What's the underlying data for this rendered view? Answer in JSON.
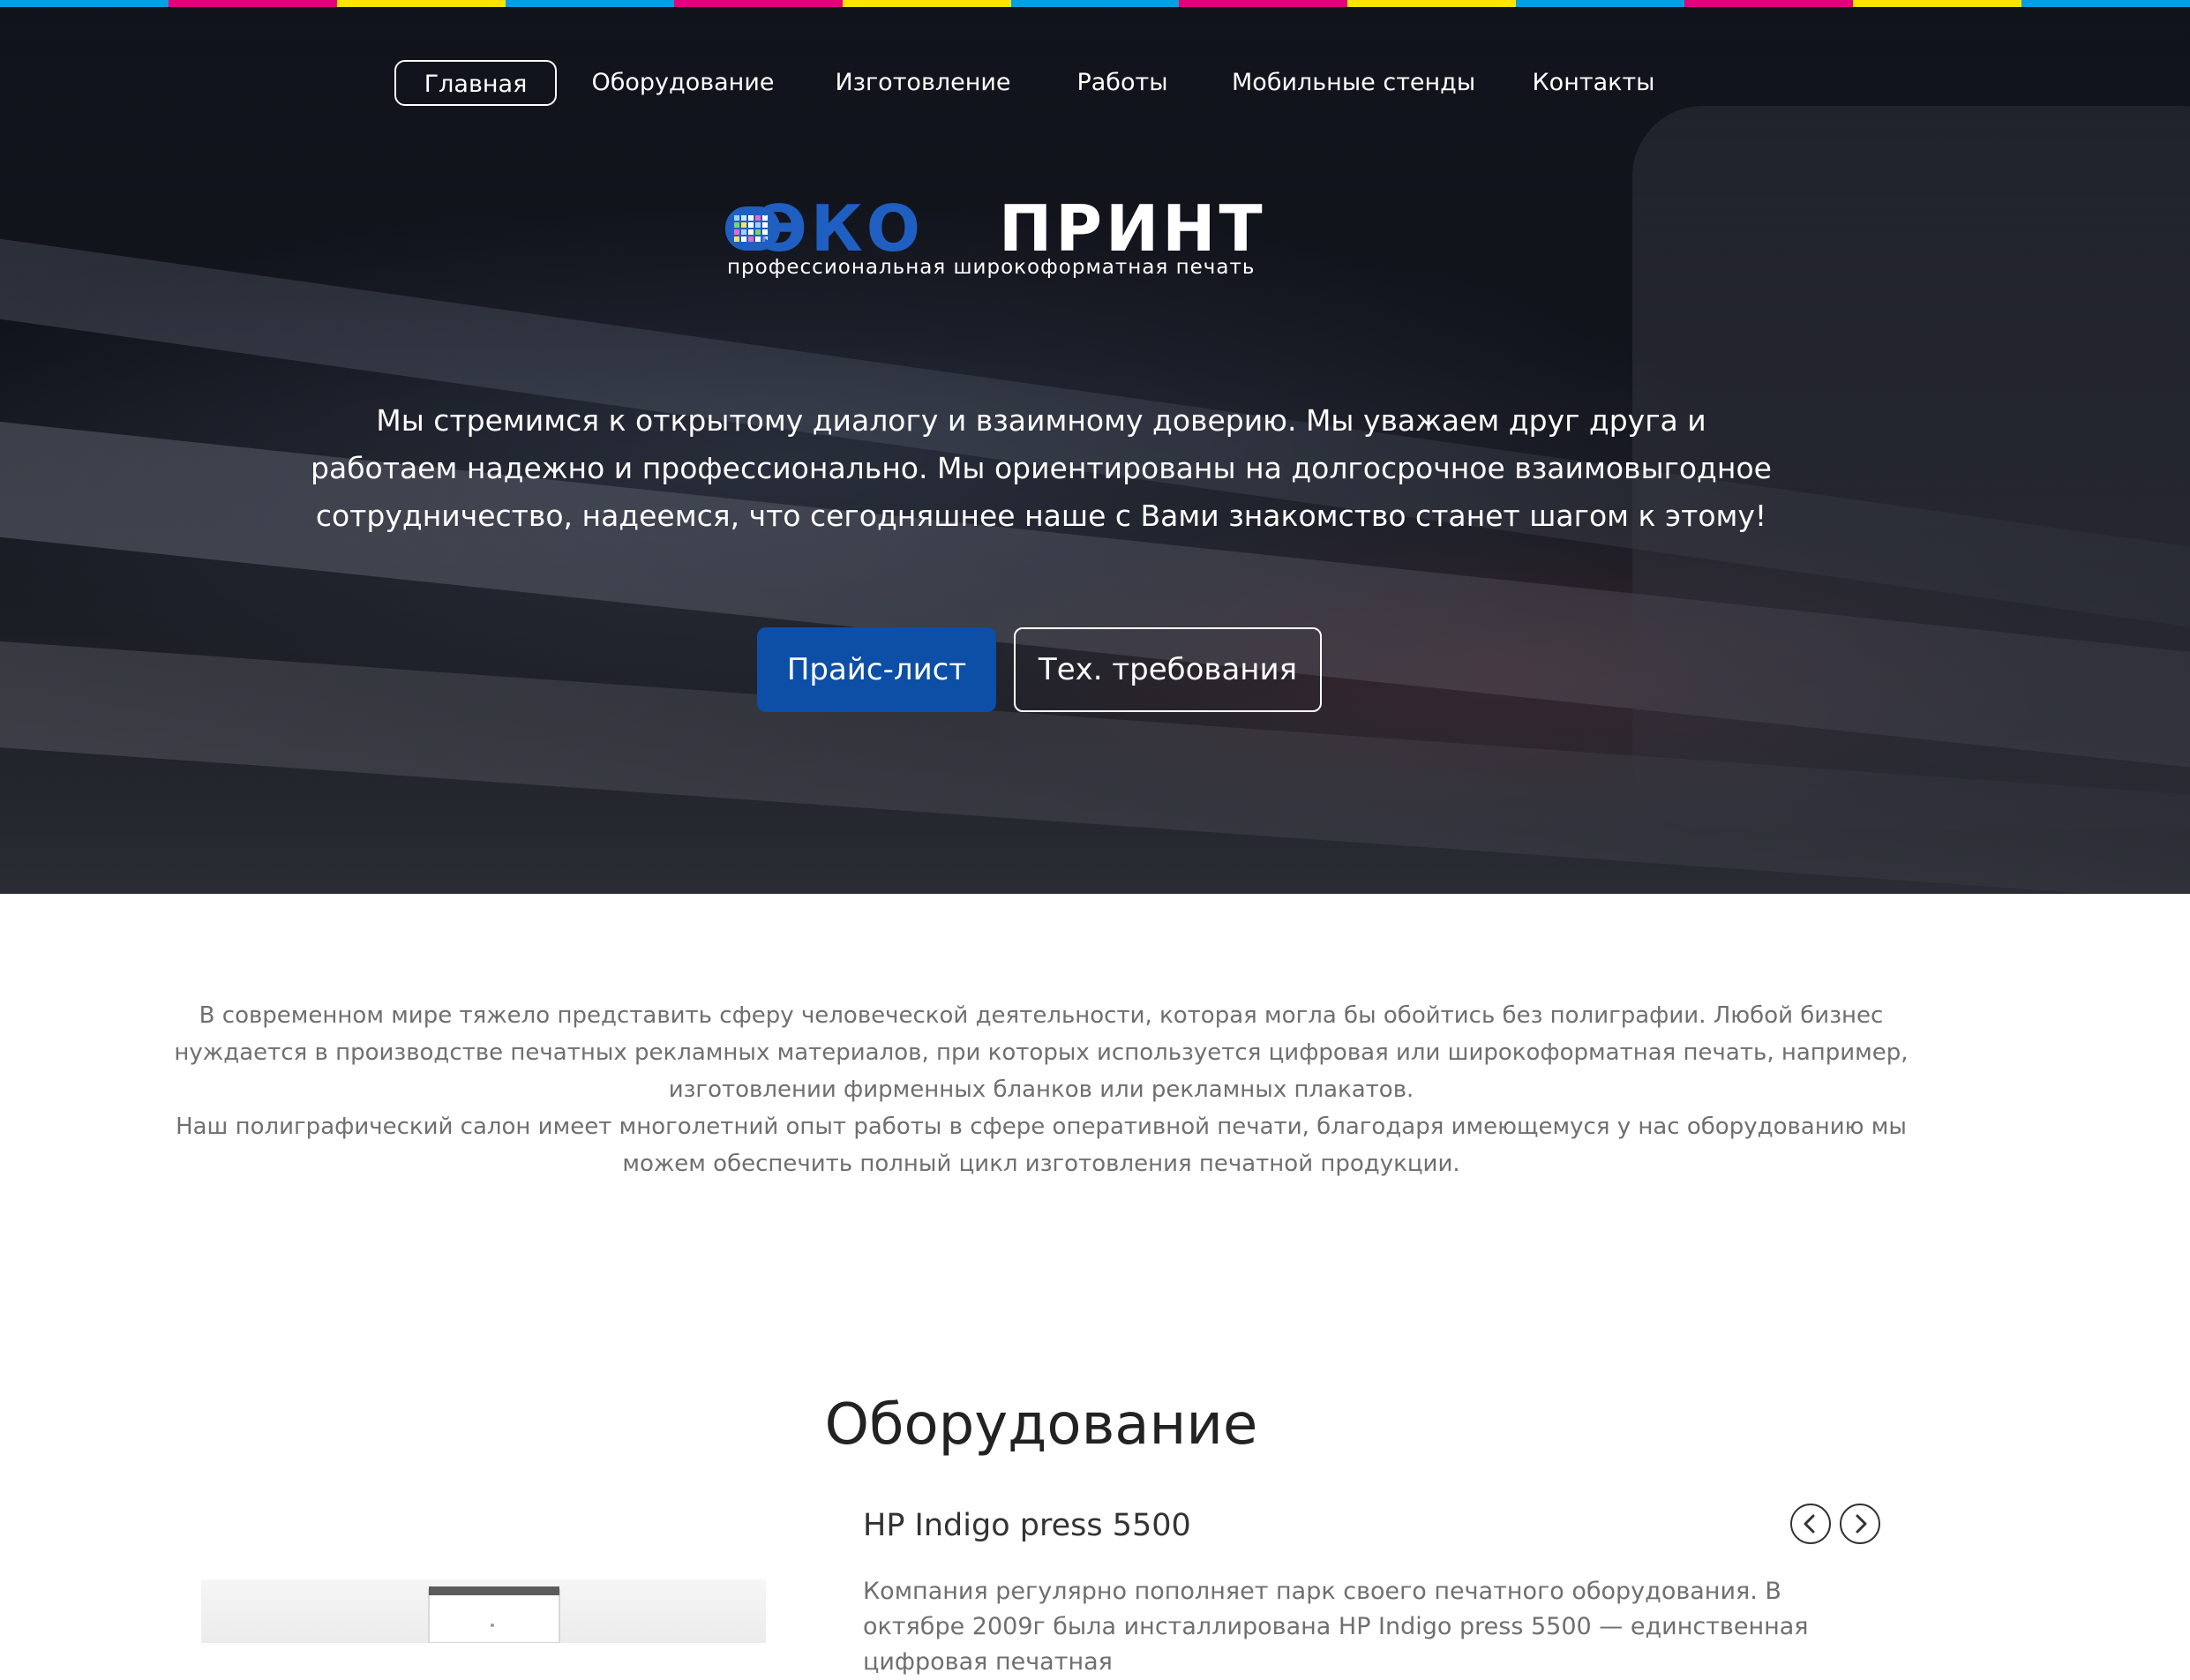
{
  "colors": {
    "cmyk": [
      "#00a0e3",
      "#e3007d",
      "#ffe500",
      "#00a0e3",
      "#e3007d",
      "#ffe500",
      "#00a0e3",
      "#e3007d",
      "#ffe500",
      "#00a0e3",
      "#e3007d",
      "#ffe500",
      "#00a0e3"
    ],
    "accent": "#0d4ea6",
    "logo_blue": "#1f5fc2"
  },
  "nav": {
    "items": [
      {
        "label": "Главная",
        "active": true
      },
      {
        "label": "Оборудование"
      },
      {
        "label": "Изготовление"
      },
      {
        "label": "Работы"
      },
      {
        "label": "Мобильные стенды"
      },
      {
        "label": "Контакты"
      }
    ]
  },
  "logo": {
    "word_part1": "ЭКО",
    "word_part2": "ПРИНТ",
    "tagline": "профессиональная широкоформатная печать"
  },
  "hero": {
    "text": "Мы стремимся к открытому диалогу и взаимному доверию. Мы уважаем друг друга и работаем надежно и профессионально. Мы ориентированы на долгосрочное взаимовыгодное сотрудничество, надеемся, что сегодняшнее наше с Вами знакомство станет шагом к этому!",
    "buttons": {
      "price": "Прайс-лист",
      "tech": "Тех. требования"
    }
  },
  "intro": {
    "p1": "В современном мире тяжело представить сферу человеческой деятельности, которая могла бы обойтись без полиграфии. Любой бизнес нуждается в производстве печатных рекламных материалов, при которых используется цифровая или широкоформатная печать, например, изготовлении фирменных бланков или рекламных плакатов.",
    "p2": "Наш полиграфический салон имеет многолетний опыт работы в сфере оперативной печати, благодаря имеющемуся у нас оборудованию мы можем обеспечить полный цикл изготовления печатной продукции."
  },
  "equipment": {
    "title": "Оборудование",
    "product_title": "HP Indigo press 5500",
    "description": "Компания регулярно пополняет парк своего печатного оборудования. В октябре 2009г была инсталлирована HP Indigo press 5500 — единственная цифровая печатная"
  }
}
